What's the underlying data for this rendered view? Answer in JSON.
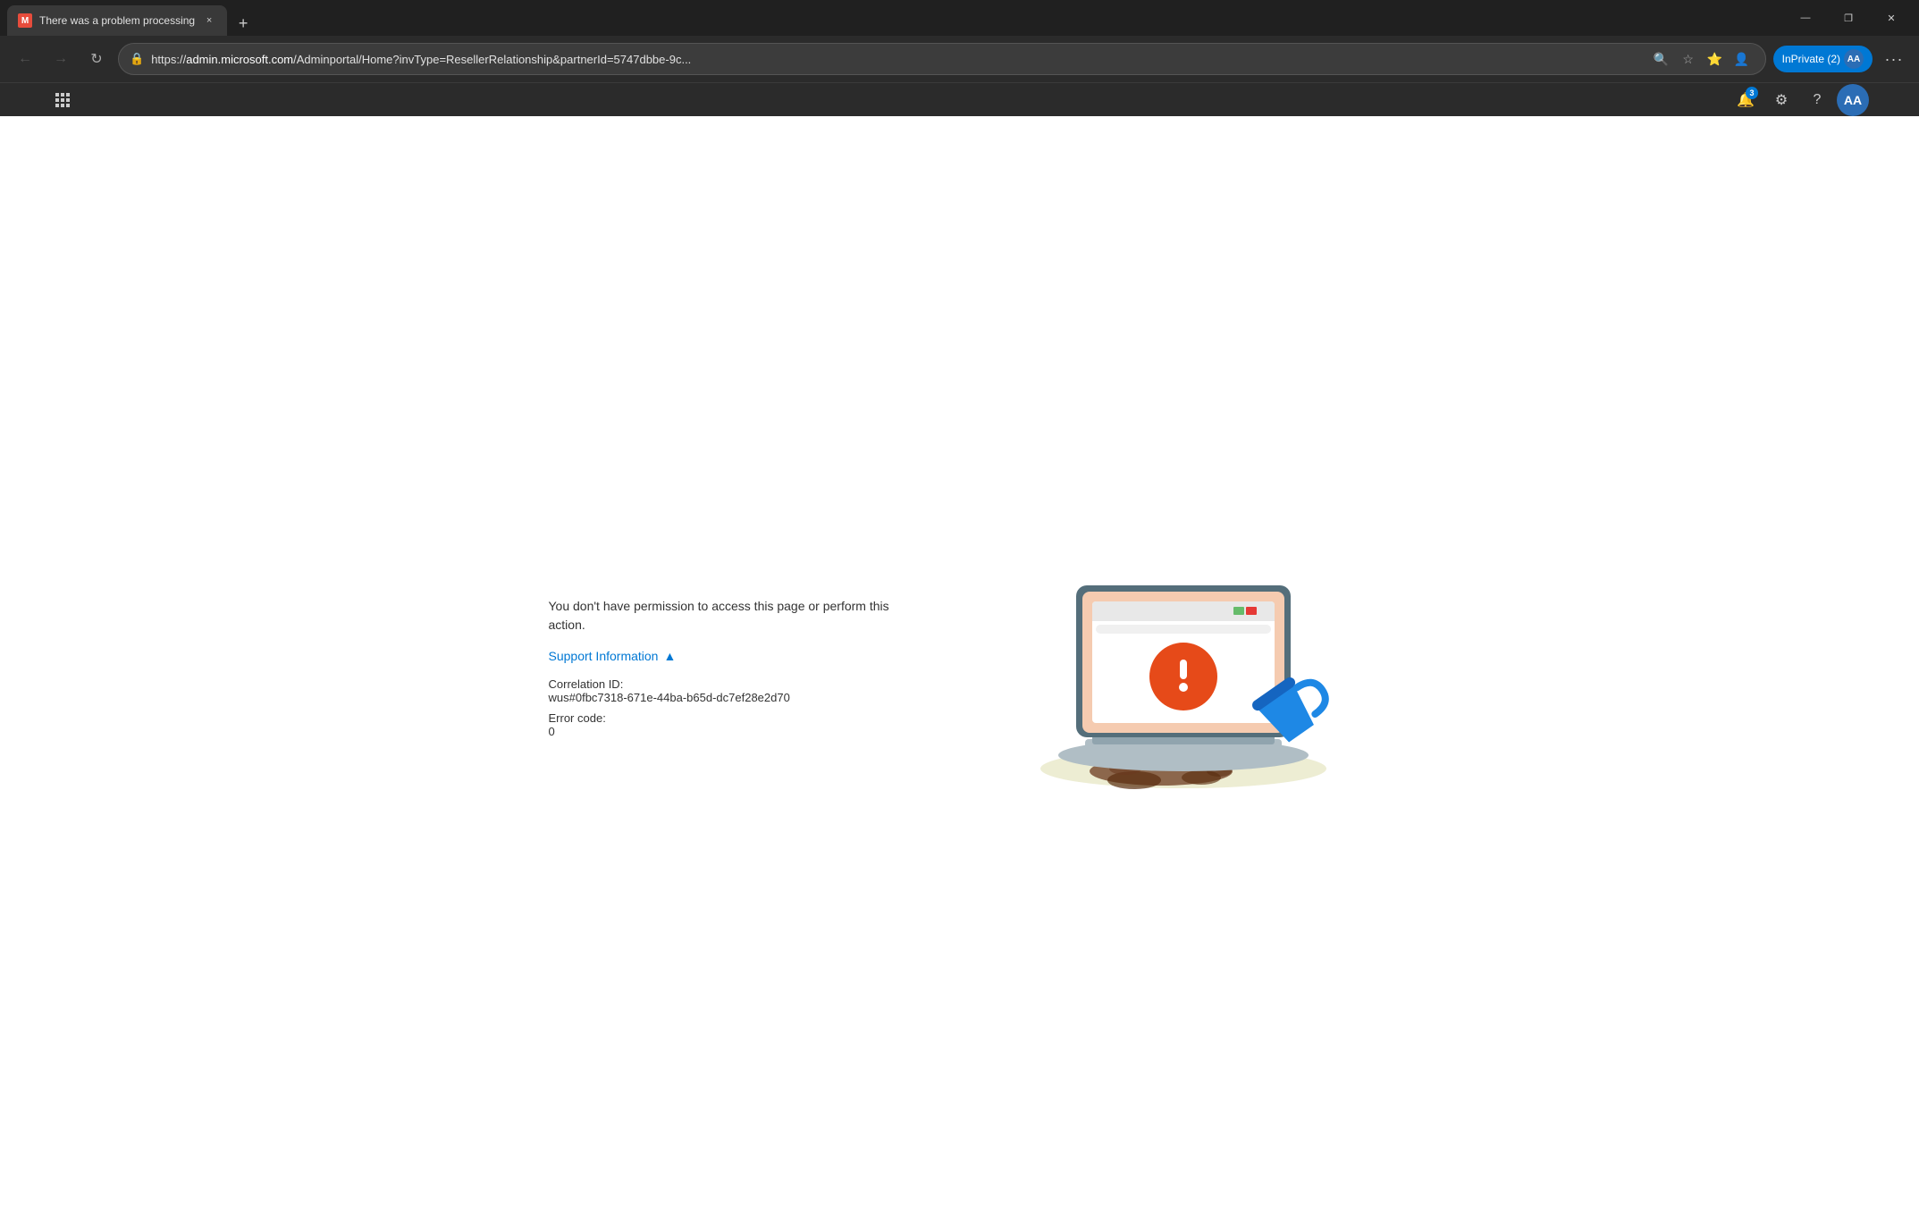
{
  "browser": {
    "title_bar_bg": "#202020",
    "tab": {
      "title": "There was a problem processing",
      "favicon_color": "#e74c3c",
      "favicon_letter": "M",
      "close_btn": "×"
    },
    "new_tab_btn": "+",
    "window_controls": {
      "minimize": "—",
      "maximize": "❐",
      "close": "✕"
    },
    "nav": {
      "back": "←",
      "forward": "→",
      "refresh": "↻"
    },
    "address_bar": {
      "lock_icon": "🔒",
      "url_prefix": "https://",
      "url_domain": "admin.microsoft.com",
      "url_path": "/Adminportal/Home?invType=ResellerRelationship&partnerId=5747dbbe-9c..."
    },
    "toolbar_icons": {
      "search": "🔍",
      "favorites": "☆",
      "collections": "⭐",
      "profile": "👤"
    },
    "inprivate_label": "InPrivate (2)",
    "more_btn": "···",
    "favbar": {
      "apps_icon": "⊞"
    },
    "right_toolbar": {
      "notifications_badge": "3",
      "settings_icon": "⚙",
      "help_icon": "?",
      "profile_initials": "AA"
    }
  },
  "page": {
    "error_message": "You don't have permission to access this page or perform this action.",
    "support_info_label": "Support Information",
    "support_info_toggle_icon": "▲",
    "correlation_id_label": "Correlation ID:",
    "correlation_id_value": "wus#0fbc7318-671e-44ba-b65d-dc7ef28e2d70",
    "error_code_label": "Error code:",
    "error_code_value": "0"
  }
}
